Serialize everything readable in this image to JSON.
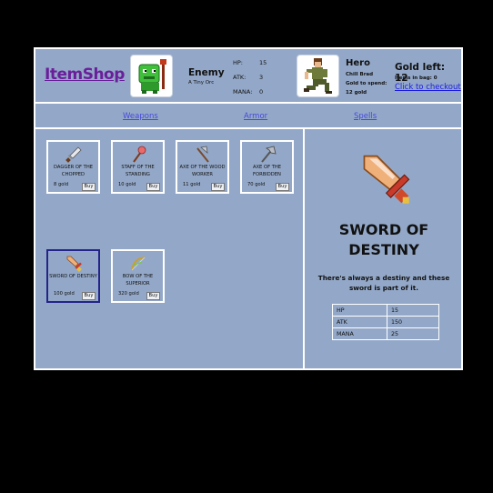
{
  "header": {
    "logo": "ItemShop",
    "enemy": {
      "name": "Enemy",
      "subtitle": "A Tiny Orc",
      "hp_label": "HP:",
      "hp": "15",
      "atk_label": "ATK:",
      "atk": "3",
      "mana_label": "MANA:",
      "mana": "0",
      "portrait_icon": "orc-icon"
    },
    "hero": {
      "name": "Hero",
      "subtitle": "Chill Brad",
      "gold_to_spend_label": "Gold to spend:",
      "gold_to_spend": "12 gold",
      "portrait_icon": "hero-icon"
    },
    "gold_left": "Gold left: 12",
    "items_in_bag": "Items in bag: 0",
    "checkout": "Click to checkout"
  },
  "nav": [
    "Weapons",
    "Armor",
    "Spells"
  ],
  "items": [
    {
      "name": "DAGGER OF THE CHOPPED",
      "price": "8 gold",
      "buy": "Buy",
      "icon": "dagger-icon"
    },
    {
      "name": "STAFF OF THE STANDING",
      "price": "10 gold",
      "buy": "Buy",
      "icon": "staff-icon"
    },
    {
      "name": "AXE OF THE WOOD WORKER",
      "price": "11 gold",
      "buy": "Buy",
      "icon": "axe-icon"
    },
    {
      "name": "AXE OF THE FORBIDDEN",
      "price": "70 gold",
      "buy": "Buy",
      "icon": "double-axe-icon"
    },
    {
      "name": "SWORD OF DESTINY",
      "price": "100 gold",
      "buy": "Buy",
      "icon": "sword-icon",
      "selected": true
    },
    {
      "name": "BOW OF THE SUPERIOR",
      "price": "320 gold",
      "buy": "Buy",
      "icon": "bow-icon"
    }
  ],
  "detail": {
    "title": "SWORD OF DESTINY",
    "description": "There's always a destiny and these sword is part of it.",
    "stats": [
      {
        "label": "HP",
        "value": "15"
      },
      {
        "label": "ATK",
        "value": "150"
      },
      {
        "label": "MANA",
        "value": "25"
      }
    ],
    "icon": "sword-icon"
  },
  "colors": {
    "background": "#93a8c8",
    "logo": "#6a1f9a",
    "link": "#4848d8",
    "selected_border": "#23238a"
  }
}
